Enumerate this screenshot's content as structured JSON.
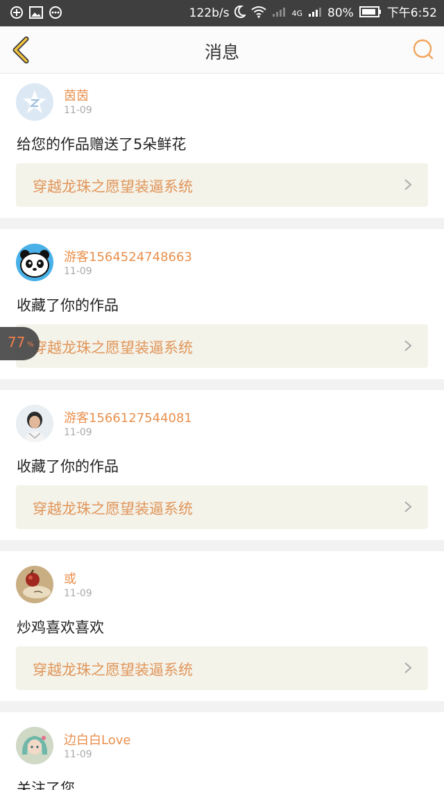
{
  "status_bar": {
    "net_speed": "122b/s",
    "signal_label": "4G",
    "battery": "80%",
    "time": "下午6:52"
  },
  "header": {
    "title": "消息"
  },
  "accent_color": "#e8904e",
  "messages": [
    {
      "user": "茵茵",
      "date": "11-09",
      "text": "给您的作品赠送了5朵鲜花",
      "work": "穿越龙珠之愿望装逼系统"
    },
    {
      "user": "游客1564524748663",
      "date": "11-09",
      "text": "收藏了你的作品",
      "work": "穿越龙珠之愿望装逼系统"
    },
    {
      "user": "游客1566127544081",
      "date": "11-09",
      "text": "收藏了你的作品",
      "work": "穿越龙珠之愿望装逼系统"
    },
    {
      "user": "或",
      "date": "11-09",
      "text": "炒鸡喜欢喜欢",
      "work": "穿越龙珠之愿望装逼系统"
    },
    {
      "user": "边白白Love",
      "date": "11-09",
      "text": "关注了您"
    }
  ],
  "float_badge": {
    "value": "77",
    "unit": "%"
  }
}
